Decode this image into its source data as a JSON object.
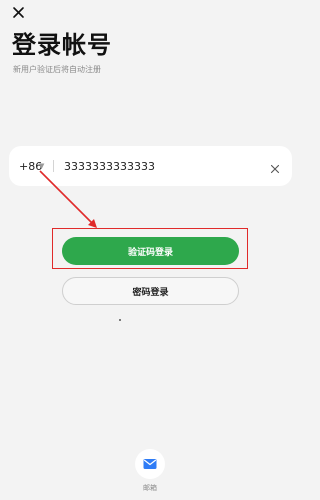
{
  "header": {
    "title": "登录帐号",
    "subtitle": "新用户验证后将自动注册"
  },
  "phone": {
    "country_code": "+86",
    "value": "3333333333333"
  },
  "actions": {
    "primary_label": "验证码登录",
    "secondary_label": "密码登录"
  },
  "footer": {
    "email_label": "邮箱"
  },
  "colors": {
    "background": "#f3f3f3",
    "primary": "#2ea84c",
    "annotation": "#e02a2a"
  },
  "icons": {
    "close": "close-icon",
    "caret": "chevron-down-icon",
    "clear": "clear-icon",
    "email": "mail-icon"
  }
}
